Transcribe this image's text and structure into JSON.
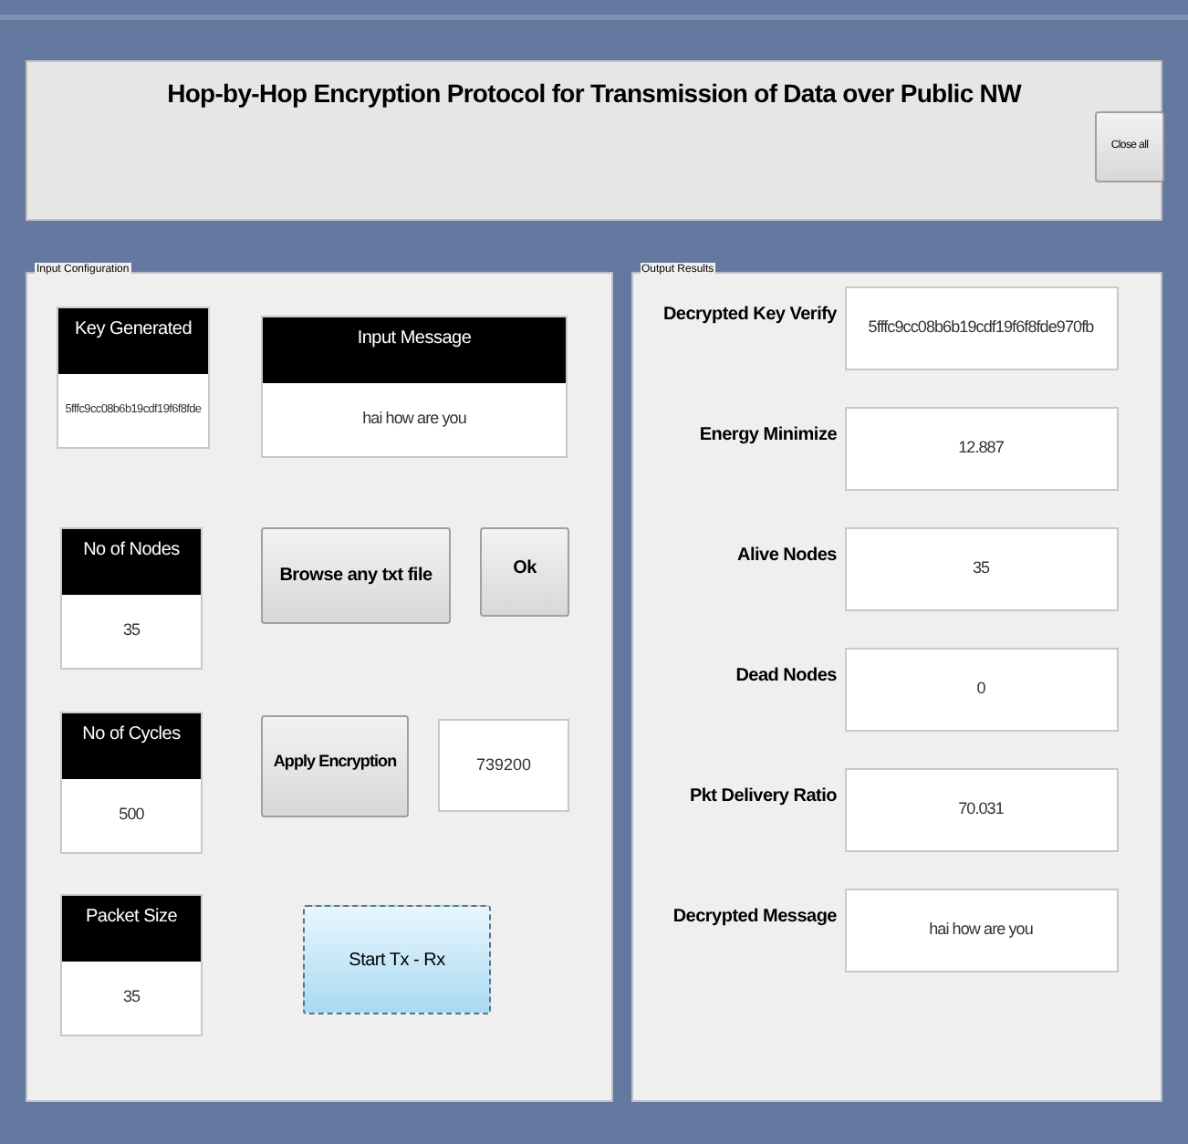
{
  "header": {
    "title": "Hop-by-Hop Encryption Protocol for Transmission of Data over Public NW",
    "close_button": "Close all"
  },
  "input_panel": {
    "title": "Input Configuration",
    "key_generated": {
      "label": "Key Generated",
      "value": "5fffc9cc08b6b19cdf19f6f8fde"
    },
    "input_message": {
      "label": "Input Message",
      "value": "hai how are you"
    },
    "nodes": {
      "label": "No of Nodes",
      "value": "35"
    },
    "browse_button": "Browse any txt  file",
    "ok_button": "Ok",
    "cycles": {
      "label": "No of Cycles",
      "value": "500"
    },
    "encrypt_button": "Apply Encryption",
    "encrypted_value": "739200",
    "packet_size": {
      "label": "Packet Size",
      "value": "35"
    },
    "start_button": {
      "label": "Start Tx - Rx",
      "focused": true
    }
  },
  "output_panel": {
    "title": "Output Results",
    "rows": [
      {
        "label": "Decrypted Key Verify",
        "value": "5fffc9cc08b6b19cdf19f6f8fde970fb"
      },
      {
        "label": "Energy Minimize",
        "value": "12.887"
      },
      {
        "label": "Alive Nodes",
        "value": "35"
      },
      {
        "label": "Dead Nodes",
        "value": "0"
      },
      {
        "label": "Pkt Delivery Ratio",
        "value": "70.031"
      },
      {
        "label": "Decrypted Message",
        "value": "hai how are you"
      }
    ]
  }
}
